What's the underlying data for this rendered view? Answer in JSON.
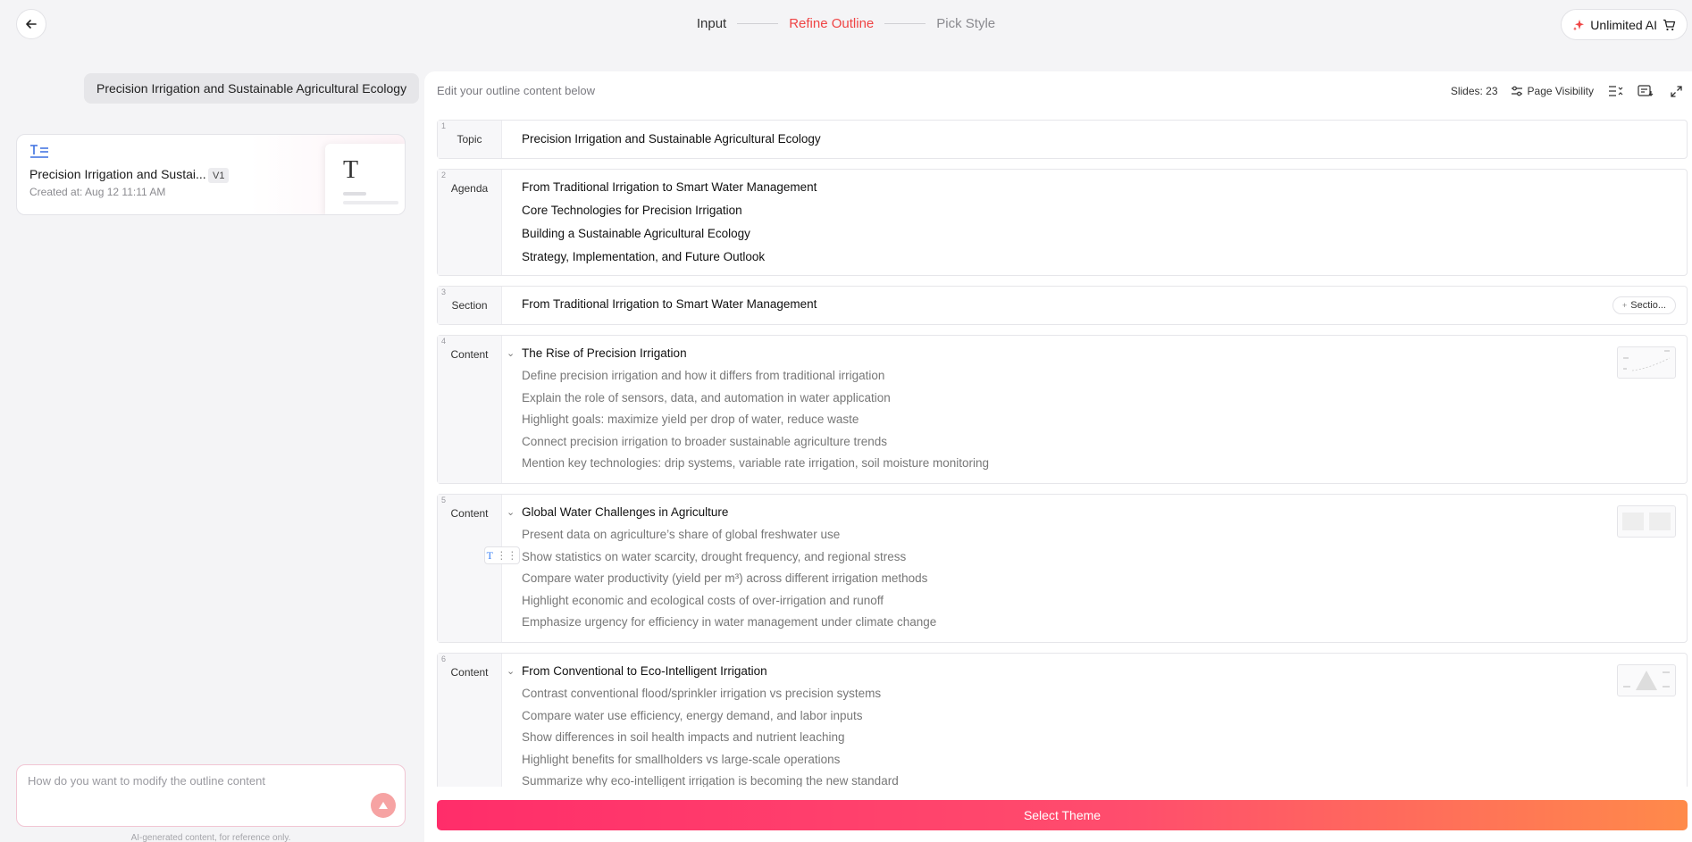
{
  "steps": [
    {
      "label": "Input"
    },
    {
      "label": "Refine Outline"
    },
    {
      "label": "Pick Style"
    }
  ],
  "header": {
    "unlimited_label": "Unlimited AI",
    "accent": "#ef4444"
  },
  "left": {
    "topic_chip": "Precision Irrigation and Sustainable Agricultural Ecology",
    "version_card": {
      "title": "Precision Irrigation and Sustai...",
      "badge": "V1",
      "created": "Created at: Aug 12 11:11 AM"
    },
    "chat_placeholder": "How do you want to modify the outline content",
    "disclaimer": "AI-generated content, for reference only."
  },
  "right": {
    "instruction": "Edit your outline content below",
    "slides_label": "Slides: 23",
    "page_visibility": "Page Visibility",
    "section_pill": "Sectio...",
    "select_theme": "Select Theme"
  },
  "outline": {
    "b1": {
      "num": "1",
      "type": "Topic",
      "lines": [
        "Precision Irrigation and Sustainable Agricultural Ecology"
      ]
    },
    "b2": {
      "num": "2",
      "type": "Agenda",
      "lines": [
        "From Traditional Irrigation to Smart Water Management",
        "Core Technologies for Precision Irrigation",
        "Building a Sustainable Agricultural Ecology",
        "Strategy, Implementation, and Future Outlook"
      ]
    },
    "b3": {
      "num": "3",
      "type": "Section",
      "lines": [
        "From Traditional Irrigation to Smart Water Management"
      ]
    },
    "b4": {
      "num": "4",
      "type": "Content",
      "title": "The Rise of Precision Irrigation",
      "lines": [
        "Define precision irrigation and how it differs from traditional irrigation",
        "Explain the role of sensors, data, and automation in water application",
        "Highlight goals: maximize yield per drop of water, reduce waste",
        "Connect precision irrigation to broader sustainable agriculture trends",
        "Mention key technologies: drip systems, variable rate irrigation, soil moisture monitoring"
      ]
    },
    "b5": {
      "num": "5",
      "type": "Content",
      "title": "Global Water Challenges in Agriculture",
      "lines": [
        "Present data on agriculture’s share of global freshwater use",
        "Show statistics on water scarcity, drought frequency, and regional stress",
        "Compare water productivity (yield per m³) across different irrigation methods",
        "Highlight economic and ecological costs of over-irrigation and runoff",
        "Emphasize urgency for efficiency in water management under climate change"
      ]
    },
    "b6": {
      "num": "6",
      "type": "Content",
      "title": "From Conventional to Eco-Intelligent Irrigation",
      "lines": [
        "Contrast conventional flood/sprinkler irrigation vs precision systems",
        "Compare water use efficiency, energy demand, and labor inputs",
        "Show differences in soil health impacts and nutrient leaching",
        "Highlight benefits for smallholders vs large-scale operations",
        "Summarize why eco-intelligent irrigation is becoming the new standard"
      ]
    }
  }
}
